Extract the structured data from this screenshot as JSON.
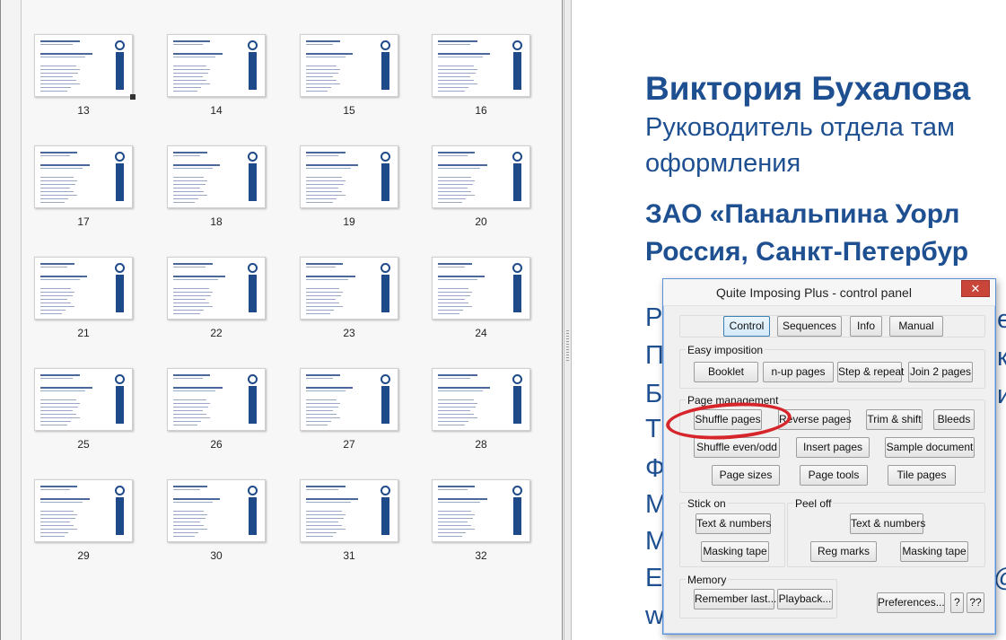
{
  "thumbnails": {
    "pages": [
      {
        "num": "13",
        "col": 0,
        "row": 0
      },
      {
        "num": "14",
        "col": 1,
        "row": 0
      },
      {
        "num": "15",
        "col": 2,
        "row": 0
      },
      {
        "num": "16",
        "col": 3,
        "row": 0
      },
      {
        "num": "17",
        "col": 0,
        "row": 1
      },
      {
        "num": "18",
        "col": 1,
        "row": 1
      },
      {
        "num": "19",
        "col": 2,
        "row": 1
      },
      {
        "num": "20",
        "col": 3,
        "row": 1
      },
      {
        "num": "21",
        "col": 0,
        "row": 2
      },
      {
        "num": "22",
        "col": 1,
        "row": 2
      },
      {
        "num": "23",
        "col": 2,
        "row": 2
      },
      {
        "num": "24",
        "col": 3,
        "row": 2
      },
      {
        "num": "25",
        "col": 0,
        "row": 3
      },
      {
        "num": "26",
        "col": 1,
        "row": 3
      },
      {
        "num": "27",
        "col": 2,
        "row": 3
      },
      {
        "num": "28",
        "col": 3,
        "row": 3
      },
      {
        "num": "29",
        "col": 0,
        "row": 4
      },
      {
        "num": "30",
        "col": 1,
        "row": 4
      },
      {
        "num": "31",
        "col": 2,
        "row": 4
      },
      {
        "num": "32",
        "col": 3,
        "row": 4
      }
    ]
  },
  "document": {
    "name": "Виктория Бухалова",
    "title_line1": "Руководитель отдела там",
    "title_line2": "оформления",
    "company_line1": "ЗАО «Панальпина Уорл",
    "company_line2": "Россия, Санкт-Петербур",
    "left_fragments": [
      "Р",
      "П",
      "Б",
      "Т",
      "Ф",
      "М",
      "М",
      "E",
      "w"
    ],
    "right_fragments": [
      "е",
      "к",
      "и",
      "@"
    ]
  },
  "panel": {
    "title": "Quite Imposing Plus - control panel",
    "close_glyph": "✕",
    "tabs": {
      "control": "Control",
      "sequences": "Sequences",
      "info": "Info",
      "manual": "Manual"
    },
    "easy_imposition": {
      "label": "Easy imposition",
      "booklet": "Booklet",
      "nup": "n-up pages",
      "step_repeat": "Step & repeat",
      "join2": "Join 2 pages"
    },
    "page_management": {
      "label": "Page management",
      "shuffle": "Shuffle pages",
      "reverse": "Reverse pages",
      "trim_shift": "Trim & shift",
      "bleeds": "Bleeds",
      "shuffle_even_odd": "Shuffle even/odd",
      "insert": "Insert pages",
      "sample": "Sample document",
      "sizes": "Page sizes",
      "tools": "Page tools",
      "tile": "Tile pages"
    },
    "stick_on": {
      "label": "Stick on",
      "text_numbers": "Text & numbers",
      "masking": "Masking tape"
    },
    "peel_off": {
      "label": "Peel off",
      "text_numbers": "Text & numbers",
      "reg_marks": "Reg marks",
      "masking": "Masking tape"
    },
    "memory": {
      "label": "Memory",
      "remember": "Remember last...",
      "playback": "Playback..."
    },
    "preferences": "Preferences...",
    "help1": "?",
    "help2": "??"
  }
}
